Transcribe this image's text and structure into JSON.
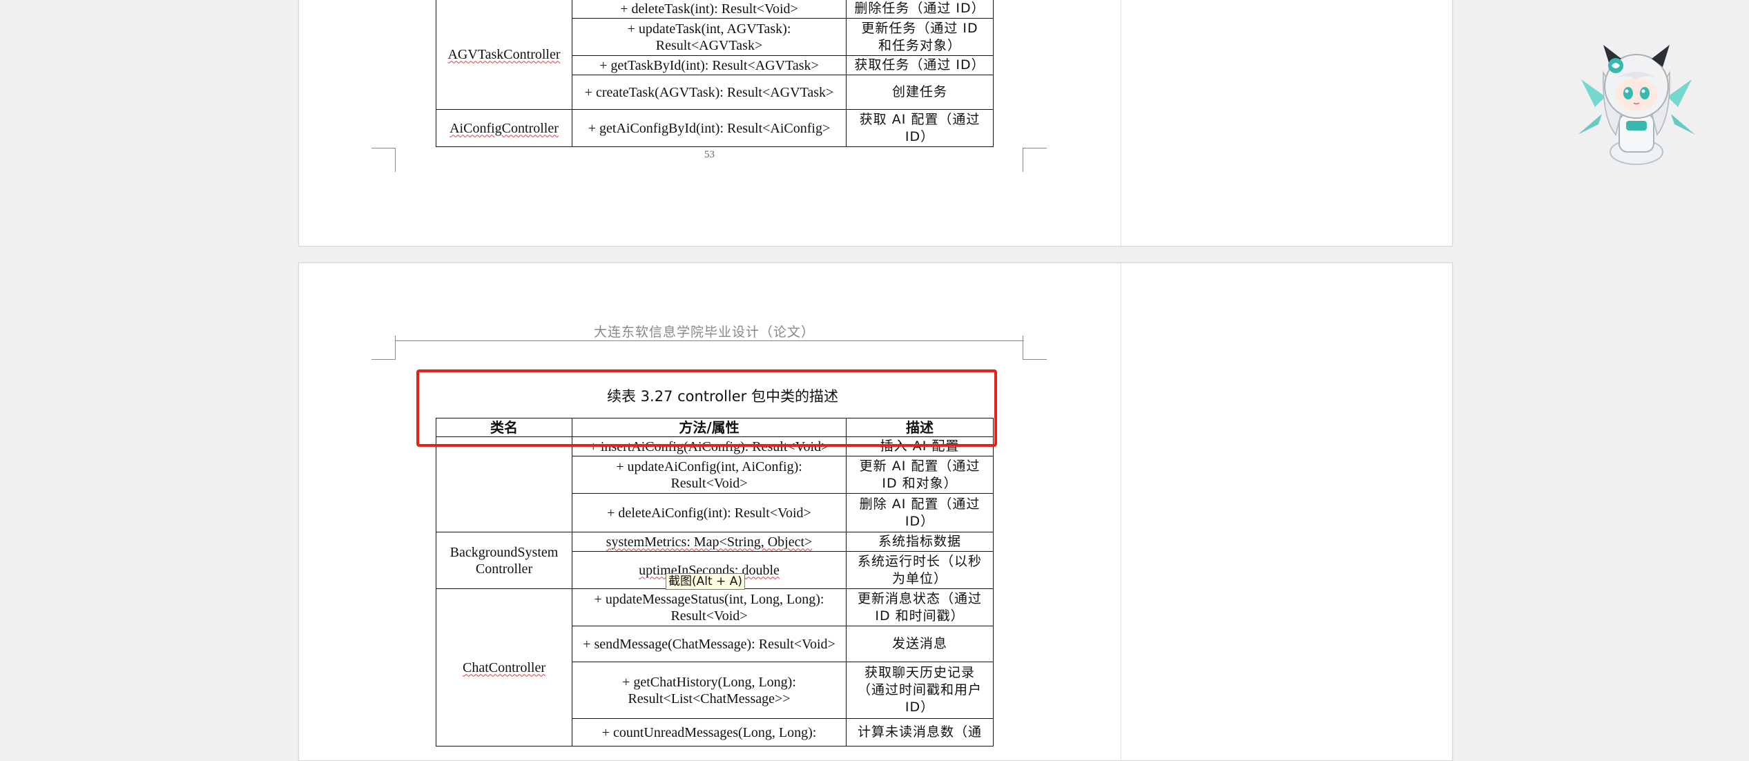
{
  "page1": {
    "rows": [
      {
        "method": "+ deleteTask(int): Result<Void>",
        "desc": "删除任务（通过 ID）"
      },
      {
        "method": "+ updateTask(int, AGVTask): Result<AGVTask>",
        "desc": "更新任务（通过 ID 和任务对象）"
      },
      {
        "method": "+ getTaskById(int): Result<AGVTask>",
        "desc": "获取任务（通过 ID）"
      },
      {
        "method": "+ createTask(AGVTask): Result<AGVTask>",
        "desc": "创建任务"
      },
      {
        "method": "+ getAiConfigById(int): Result<AiConfig>",
        "desc": "获取 AI 配置（通过 ID）"
      }
    ],
    "class_agv": "AGVTaskController",
    "class_aiconfig": "AiConfigController",
    "page_number": "53"
  },
  "page2": {
    "header": "大连东软信息学院毕业设计（论文）",
    "caption": "续表 3.27 controller 包中类的描述",
    "columns": {
      "class": "类名",
      "method": "方法/属性",
      "desc": "描述"
    },
    "rows": [
      {
        "method": "+ insertAiConfig(AiConfig): Result<Void>",
        "desc": "插入 AI 配置"
      },
      {
        "method": "+ updateAiConfig(int, AiConfig): Result<Void>",
        "desc": "更新 AI 配置（通过 ID 和对象）"
      },
      {
        "method": "+ deleteAiConfig(int): Result<Void>",
        "desc": "删除 AI 配置（通过 ID）"
      },
      {
        "method": "systemMetrics: Map<String, Object>",
        "desc": "系统指标数据"
      },
      {
        "method": "uptimeInSeconds: double",
        "desc": "系统运行时长（以秒为单位）"
      },
      {
        "method": "+ updateMessageStatus(int, Long, Long): Result<Void>",
        "desc": "更新消息状态（通过 ID 和时间戳）"
      },
      {
        "method": "+ sendMessage(ChatMessage): Result<Void>",
        "desc": "发送消息"
      },
      {
        "method": "+ getChatHistory(Long, Long): Result<List<ChatMessage>>",
        "desc": "获取聊天历史记录（通过时间戳和用户 ID）"
      },
      {
        "method": "+ countUnreadMessages(Long, Long):",
        "desc": "计算未读消息数（通"
      }
    ],
    "class_background": "BackgroundSystem Controller",
    "class_chat": "ChatController"
  },
  "tooltip": "截图(Alt + A)",
  "colors": {
    "highlight": "#e5231b",
    "background": "#f0f0f0",
    "tooltip_bg": "#fdfde0"
  }
}
